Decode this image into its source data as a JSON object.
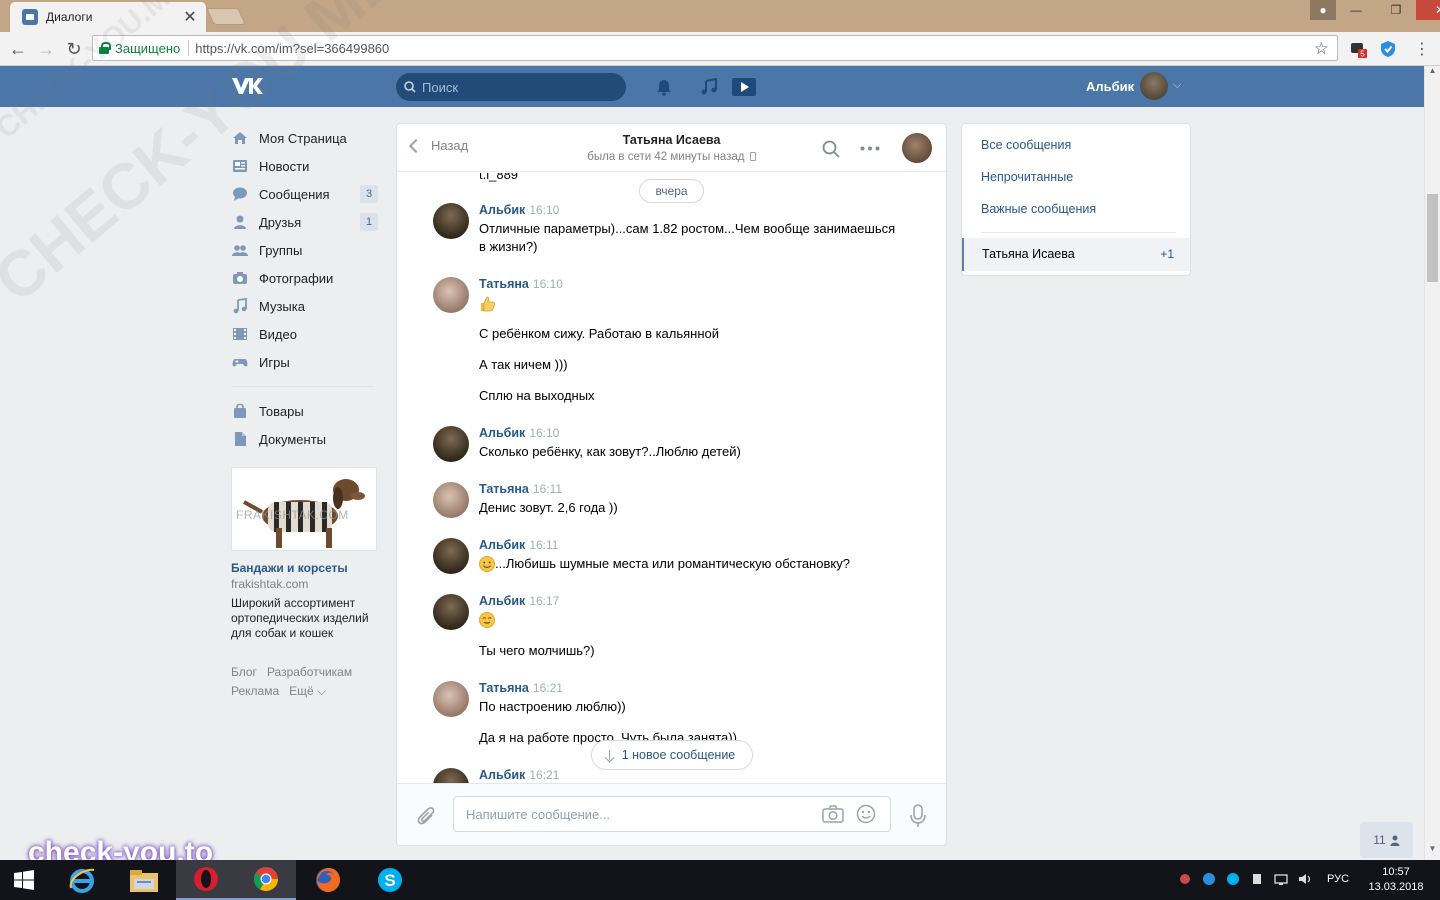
{
  "browser": {
    "tab_title": "Диалоги",
    "tab_close": "✕",
    "secure_label": "Защищено",
    "url": "https://vk.com/im?sel=366499860",
    "ext_badge": "5"
  },
  "header": {
    "search_placeholder": "Поиск",
    "user_name": "Альбик"
  },
  "left_menu": {
    "items": [
      {
        "label": "Моя Страница",
        "icon": "home-icon"
      },
      {
        "label": "Новости",
        "icon": "news-icon"
      },
      {
        "label": "Сообщения",
        "icon": "messages-icon",
        "count": "3"
      },
      {
        "label": "Друзья",
        "icon": "friends-icon",
        "count": "1"
      },
      {
        "label": "Группы",
        "icon": "groups-icon"
      },
      {
        "label": "Фотографии",
        "icon": "camera-icon"
      },
      {
        "label": "Музыка",
        "icon": "music-icon"
      },
      {
        "label": "Видео",
        "icon": "video-icon"
      },
      {
        "label": "Игры",
        "icon": "games-icon"
      }
    ],
    "extra_items": [
      {
        "label": "Товары",
        "icon": "bag-icon"
      },
      {
        "label": "Документы",
        "icon": "document-icon"
      }
    ],
    "ad": {
      "image_text": "FRAKISHTAK.COM",
      "title": "Бандажи и корсеты",
      "site": "frakishtak.com",
      "text": "Широкий ассортимент ортопедических изделий для собак и кошек"
    },
    "footer": {
      "blog": "Блог",
      "developers": "Разработчикам",
      "ads": "Реклама",
      "more": "Ещё ⌵"
    }
  },
  "chat": {
    "back_label": "Назад",
    "name": "Татьяна Исаева",
    "status": "была в сети 42 минуты назад",
    "cut_text": "t.i_889",
    "date_divider": "вчера",
    "messages": [
      {
        "author": "Альбик",
        "time": "16:10",
        "lines": [
          "Отличные параметры)...сам 1.82 ростом...Чем вообще занимаешься в жизни?)"
        ]
      },
      {
        "author": "Татьяна",
        "time": "16:10",
        "lines": [
          "С ребёнком сижу. Работаю в кальянной",
          "А так ничем )))",
          "Сплю на выходных"
        ]
      },
      {
        "author": "Альбик",
        "time": "16:10",
        "lines": [
          "Сколько ребёнку, как зовут?..Люблю детей)"
        ]
      },
      {
        "author": "Татьяна",
        "time": "16:11",
        "lines": [
          "Денис зовут. 2,6 года ))"
        ]
      },
      {
        "author": "Альбик",
        "time": "16:11",
        "lines": [
          "...Любишь шумные места или романтическую обстановку?"
        ]
      },
      {
        "author": "Альбик",
        "time": "16:17",
        "lines": [
          "Ты чего молчишь?)"
        ]
      },
      {
        "author": "Татьяна",
        "time": "16:21",
        "lines": [
          "По настроению люблю))",
          "Да я на работе просто. Чуть была занята))"
        ]
      },
      {
        "author": "Альбик",
        "time": "16:21",
        "lines": []
      }
    ],
    "new_message_label": "1 новое сообщение",
    "input_placeholder": "Напишите сообщение..."
  },
  "right_panel": {
    "all": "Все сообщения",
    "unread": "Непрочитанные",
    "important": "Важные сообщения",
    "selected_name": "Татьяна Исаева",
    "selected_count": "+1"
  },
  "online_count": "11",
  "watermark": {
    "big": "CHECK-YOU.ME",
    "small": "CHECK-YOU.ME",
    "brand": "check-you.to"
  },
  "taskbar": {
    "lang": "РУС",
    "time": "10:57",
    "date": "13.03.2018"
  },
  "colors": {
    "vk_blue": "#4a76a8",
    "link": "#2a5885",
    "tab_bar": "#c3a686"
  }
}
